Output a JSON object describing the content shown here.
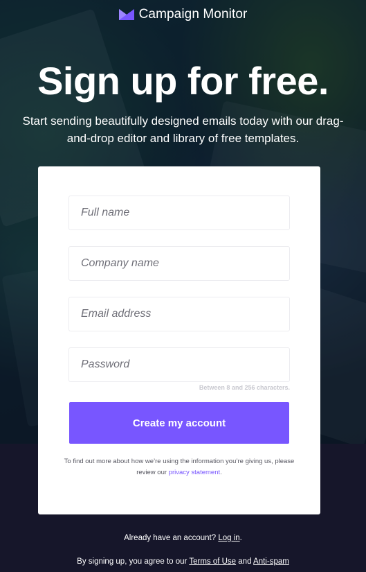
{
  "brand": {
    "name": "Campaign Monitor",
    "icon": "campaign-monitor-envelope-icon",
    "accent": "#7856ff"
  },
  "hero": {
    "headline": "Sign up for free.",
    "subhead": "Start sending beautifully designed emails today with our drag-and-drop editor and library of free templates."
  },
  "form": {
    "full_name_placeholder": "Full name",
    "company_placeholder": "Company name",
    "email_placeholder": "Email address",
    "password_placeholder": "Password",
    "password_hint": "Between 8 and 256 characters.",
    "submit_label": "Create my account",
    "privacy_prefix": "To find out more about how we’re using the information you’re giving us, please review our ",
    "privacy_link": "privacy statement",
    "privacy_suffix": "."
  },
  "footer": {
    "login_prefix": "Already have an account? ",
    "login_link": "Log in",
    "login_suffix": ".",
    "terms_prefix": "By signing up, you agree to our ",
    "terms_link": "Terms of Use",
    "terms_and": " and ",
    "antispam_link": "Anti-spam"
  }
}
